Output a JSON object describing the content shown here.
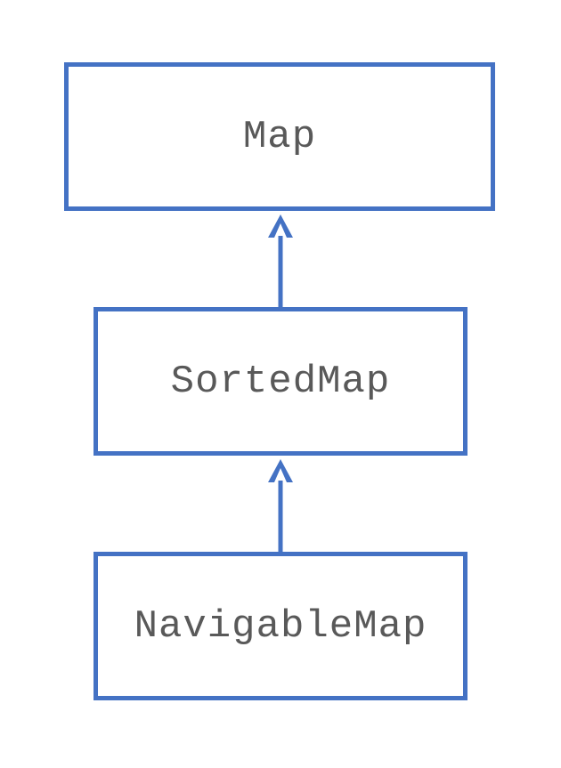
{
  "diagram": {
    "nodes": [
      {
        "id": "map",
        "label": "Map"
      },
      {
        "id": "sortedmap",
        "label": "SortedMap"
      },
      {
        "id": "navigablemap",
        "label": "NavigableMap"
      }
    ],
    "edges": [
      {
        "from": "sortedmap",
        "to": "map"
      },
      {
        "from": "navigablemap",
        "to": "sortedmap"
      }
    ],
    "colors": {
      "border": "#4472C4",
      "text": "#595959"
    }
  }
}
